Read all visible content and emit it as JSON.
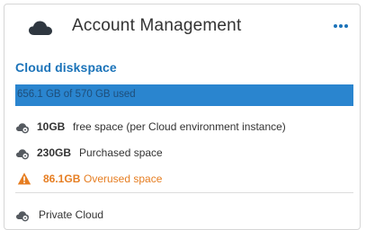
{
  "header": {
    "title": "Account Management",
    "icon": "cloud-icon",
    "menu_icon": "more-horizontal-icon"
  },
  "diskspace": {
    "section_title": "Cloud diskspace",
    "usage_text": "656.1 GB of 570 GB used",
    "used_gb": 656.1,
    "total_gb": 570,
    "fill_fraction": 1.0,
    "bar_color": "#2a85cf"
  },
  "rows": [
    {
      "icon": "cloud-disk-icon",
      "value": "10GB",
      "desc": "free space (per Cloud environment instance)"
    },
    {
      "icon": "cloud-disk-icon",
      "value": "230GB",
      "desc": "Purchased space"
    },
    {
      "icon": "warning-icon",
      "value": "86.1GB",
      "desc": "Overused space",
      "color": "#e67e22"
    }
  ],
  "footer_item": {
    "icon": "cloud-disk-icon",
    "label": "Private Cloud"
  },
  "colors": {
    "accent": "#1b73b9",
    "warning": "#e67e22",
    "text": "#333333"
  }
}
